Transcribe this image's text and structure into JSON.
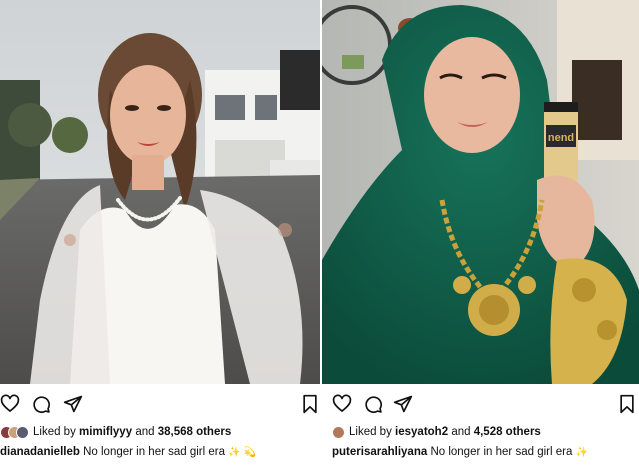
{
  "posts": [
    {
      "liked_prefix": "Liked by",
      "liked_user": "mimiflyyy",
      "liked_and": "and",
      "liked_count": "38,568 others",
      "caption_user": "dianadanielleb",
      "caption_text": "No longer in her sad girl era",
      "caption_emoji": "✨ 💫",
      "avatar_colors": [
        "#8a3c3c",
        "#c9a27a",
        "#5a5a70"
      ]
    },
    {
      "liked_prefix": "Liked by",
      "liked_user": "iesyatoh2",
      "liked_and": "and",
      "liked_count": "4,528 others",
      "caption_user": "puterisarahliyana",
      "caption_text": "No longer in her sad girl era",
      "caption_emoji": "✨",
      "avatar_colors": [
        "#b07a5a"
      ]
    }
  ],
  "icons": [
    "heart-icon",
    "comment-icon",
    "share-icon",
    "bookmark-icon"
  ],
  "colors": {
    "text": "#111111",
    "accent_green": "#0d5a45",
    "gold": "#c9a23a"
  }
}
